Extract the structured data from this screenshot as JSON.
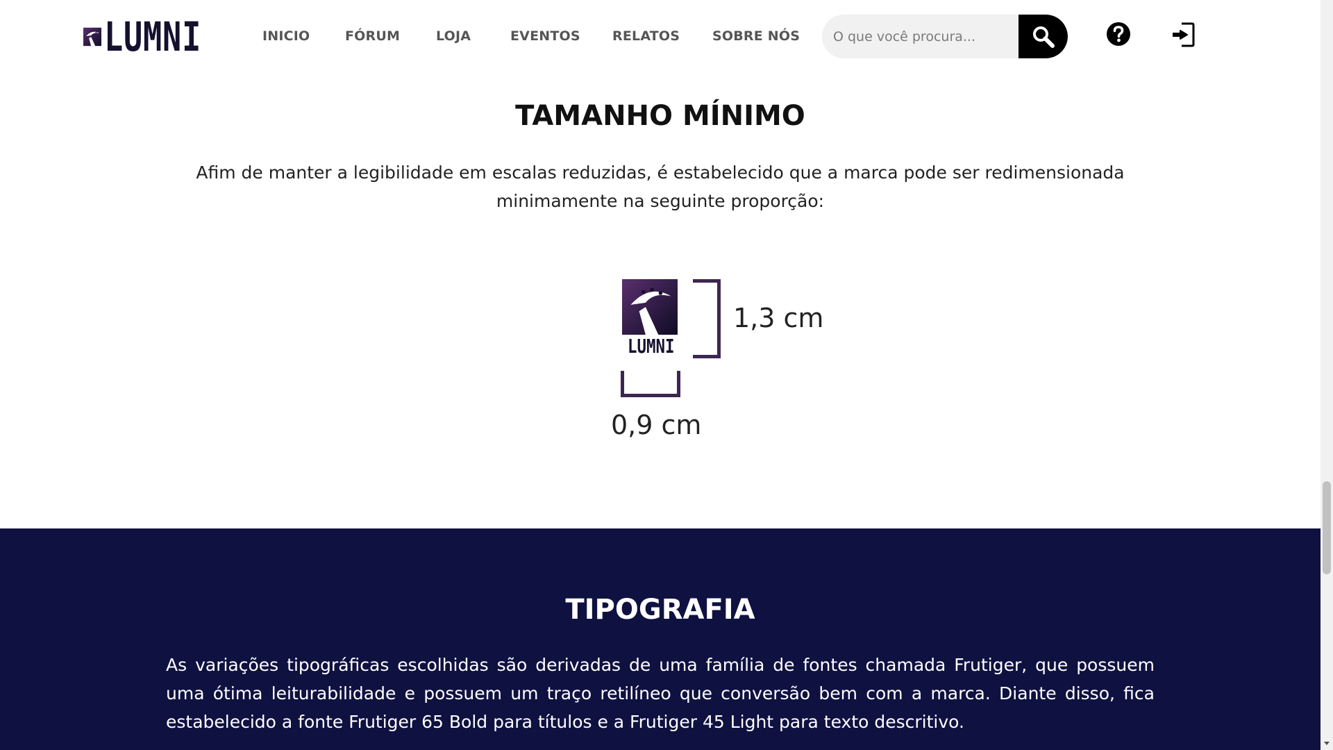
{
  "header": {
    "logo_text": "LUMNI",
    "nav": [
      {
        "label": "INICIO"
      },
      {
        "label": "FÓRUM"
      },
      {
        "label": "LOJA"
      },
      {
        "label": "EVENTOS"
      },
      {
        "label": "RELATOS"
      },
      {
        "label": "SOBRE NÓS"
      }
    ],
    "search": {
      "placeholder": "O que você procura...",
      "value": "",
      "button_icon": "search-icon"
    },
    "help_icon": "question-circle-icon",
    "login_icon": "sign-in-icon"
  },
  "min_size": {
    "title": "TAMANHO MÍNIMO",
    "text": "Afim de manter a legibilidade em escalas reduzidas, é estabelecido que a marca pode ser redimensionada minimamente na seguinte proporção:",
    "logo_text": "LUMNI",
    "height_label": "1,3 cm",
    "width_label": "0,9 cm"
  },
  "typography": {
    "title": "TIPOGRAFIA",
    "text": "As variações tipográficas escolhidas são derivadas de uma família de fontes chamada Frutiger, que possuem uma ótima leiturabilidade e possuem um traço retilíneo que conversão bem com a marca. Diante disso, fica estabelecido a fonte Frutiger 65 Bold para títulos e a Frutiger 45 Light para texto descritivo."
  },
  "colors": {
    "brand_dark": "#14102e",
    "brand_purple": "#3d2751",
    "section_navy": "#0f1140"
  }
}
